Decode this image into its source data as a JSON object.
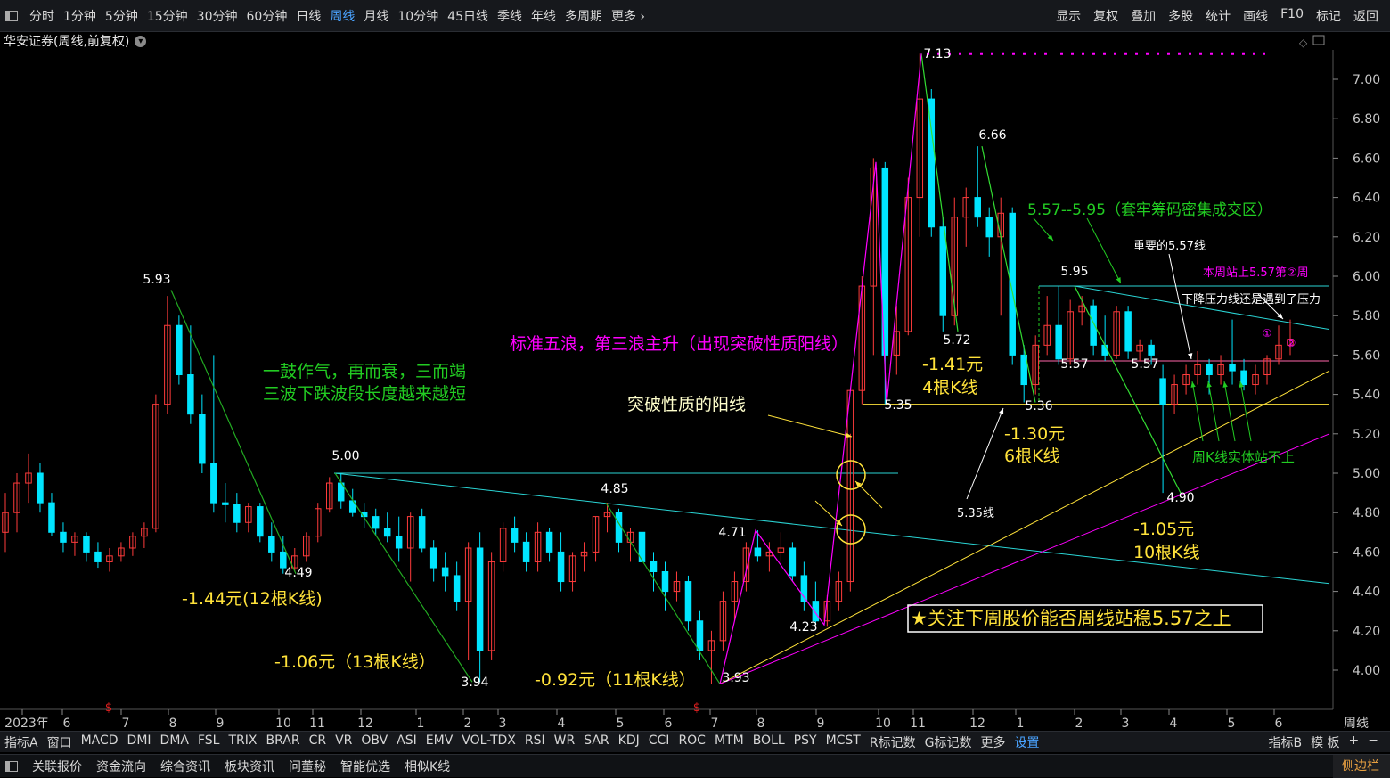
{
  "top_menu": {
    "periods": [
      "分时",
      "1分钟",
      "5分钟",
      "15分钟",
      "30分钟",
      "60分钟",
      "日线",
      "周线",
      "月线",
      "10分钟",
      "45日线",
      "季线",
      "年线",
      "多周期",
      "更多 ›"
    ],
    "active": "周线",
    "right": [
      "显示",
      "复权",
      "叠加",
      "多股",
      "统计",
      "画线",
      "F10",
      "标记",
      "返回"
    ]
  },
  "title": "华安证券(周线,前复权)",
  "price_axis": [
    "7.00",
    "6.80",
    "6.60",
    "6.40",
    "6.20",
    "6.00",
    "5.80",
    "5.60",
    "5.40",
    "5.20",
    "5.00",
    "4.80",
    "4.60",
    "4.40",
    "4.20",
    "4.00"
  ],
  "time_axis": [
    "2023年",
    "6",
    "7",
    "8",
    "9",
    "10",
    "11",
    "12",
    "1",
    "2",
    "3",
    "4",
    "5",
    "6",
    "7",
    "8",
    "9",
    "10",
    "11",
    "12",
    "1",
    "2",
    "3",
    "4",
    "5",
    "6"
  ],
  "time_axis_right": "周线",
  "chart_data": {
    "type": "candlestick",
    "period": "周线",
    "price_labels": [
      "5.93",
      "4.49",
      "5.00",
      "3.94",
      "4.85",
      "3.93",
      "4.71",
      "4.23",
      "7.13",
      "5.35",
      "6.66",
      "5.72",
      "5.36",
      "5.95",
      "5.57",
      "5.57",
      "4.90"
    ],
    "annotations": [
      "一鼓作气，再而衰，三而竭",
      "三波下跌波段长度越来越短",
      "-1.44元(12根K线)",
      "-1.06元（13根K线）",
      "-0.92元（11根K线）",
      "标准五浪，第三浪主升（出现突破性质阳线）",
      "突破性质的阳线",
      "-1.41元",
      "4根K线",
      "-1.30元",
      "6根K线",
      "5.35线",
      "5.57--5.95（套牢筹码密集成交区）",
      "重要的5.57线",
      "本周站上5.57第②周",
      "下降压力线还是遇到了压力",
      "-1.05元",
      "10根K线",
      "周K线实体站不上",
      "★关注下周股价能否周线站稳5.57之上"
    ],
    "circle_marks": [
      "①",
      "②"
    ],
    "candles": [
      [
        4.7,
        4.9,
        4.6,
        4.8
      ],
      [
        4.8,
        5.0,
        4.7,
        4.95
      ],
      [
        4.95,
        5.1,
        4.85,
        5.0
      ],
      [
        5.0,
        5.05,
        4.8,
        4.85
      ],
      [
        4.85,
        4.9,
        4.68,
        4.7
      ],
      [
        4.7,
        4.75,
        4.6,
        4.65
      ],
      [
        4.65,
        4.7,
        4.58,
        4.68
      ],
      [
        4.68,
        4.7,
        4.55,
        4.6
      ],
      [
        4.6,
        4.65,
        4.52,
        4.55
      ],
      [
        4.55,
        4.62,
        4.5,
        4.58
      ],
      [
        4.58,
        4.65,
        4.55,
        4.62
      ],
      [
        4.62,
        4.7,
        4.58,
        4.68
      ],
      [
        4.68,
        4.75,
        4.62,
        4.72
      ],
      [
        4.72,
        5.4,
        4.7,
        5.35
      ],
      [
        5.35,
        5.9,
        5.3,
        5.75
      ],
      [
        5.75,
        5.8,
        5.45,
        5.5
      ],
      [
        5.5,
        5.75,
        5.25,
        5.3
      ],
      [
        5.3,
        5.4,
        5.0,
        5.05
      ],
      [
        5.05,
        5.6,
        4.8,
        4.85
      ],
      [
        4.85,
        4.95,
        4.75,
        4.84
      ],
      [
        4.84,
        4.9,
        4.7,
        4.75
      ],
      [
        4.75,
        4.85,
        4.7,
        4.83
      ],
      [
        4.83,
        4.85,
        4.65,
        4.68
      ],
      [
        4.68,
        4.75,
        4.55,
        4.6
      ],
      [
        4.6,
        4.68,
        4.49,
        4.52
      ],
      [
        4.52,
        4.62,
        4.5,
        4.58
      ],
      [
        4.58,
        4.7,
        4.55,
        4.68
      ],
      [
        4.68,
        4.85,
        4.65,
        4.82
      ],
      [
        4.82,
        4.98,
        4.8,
        4.95
      ],
      [
        4.95,
        5.0,
        4.82,
        4.86
      ],
      [
        4.86,
        4.92,
        4.78,
        4.8
      ],
      [
        4.8,
        4.85,
        4.72,
        4.78
      ],
      [
        4.78,
        4.82,
        4.68,
        4.72
      ],
      [
        4.72,
        4.8,
        4.65,
        4.68
      ],
      [
        4.68,
        4.78,
        4.55,
        4.62
      ],
      [
        4.62,
        4.8,
        4.45,
        4.78
      ],
      [
        4.78,
        4.82,
        4.6,
        4.62
      ],
      [
        4.62,
        4.66,
        4.45,
        4.52
      ],
      [
        4.52,
        4.6,
        4.4,
        4.48
      ],
      [
        4.48,
        4.55,
        4.3,
        4.35
      ],
      [
        4.35,
        4.65,
        4.05,
        4.62
      ],
      [
        4.62,
        4.7,
        3.94,
        4.1
      ],
      [
        4.1,
        4.6,
        4.05,
        4.55
      ],
      [
        4.55,
        4.75,
        4.5,
        4.72
      ],
      [
        4.72,
        4.78,
        4.6,
        4.65
      ],
      [
        4.65,
        4.7,
        4.5,
        4.55
      ],
      [
        4.55,
        4.75,
        4.5,
        4.7
      ],
      [
        4.7,
        4.72,
        4.55,
        4.6
      ],
      [
        4.6,
        4.7,
        4.4,
        4.45
      ],
      [
        4.45,
        4.6,
        4.4,
        4.58
      ],
      [
        4.58,
        4.65,
        4.5,
        4.6
      ],
      [
        4.6,
        4.78,
        4.55,
        4.78
      ],
      [
        4.78,
        4.85,
        4.7,
        4.8
      ],
      [
        4.8,
        4.82,
        4.6,
        4.65
      ],
      [
        4.65,
        4.72,
        4.55,
        4.7
      ],
      [
        4.7,
        4.75,
        4.5,
        4.55
      ],
      [
        4.55,
        4.6,
        4.4,
        4.5
      ],
      [
        4.5,
        4.55,
        4.3,
        4.4
      ],
      [
        4.4,
        4.5,
        4.35,
        4.45
      ],
      [
        4.45,
        4.48,
        4.2,
        4.25
      ],
      [
        4.25,
        4.3,
        4.05,
        4.1
      ],
      [
        4.1,
        4.2,
        3.93,
        4.15
      ],
      [
        4.15,
        4.4,
        4.1,
        4.35
      ],
      [
        4.35,
        4.5,
        4.25,
        4.45
      ],
      [
        4.45,
        4.65,
        4.4,
        4.62
      ],
      [
        4.62,
        4.71,
        4.55,
        4.58
      ],
      [
        4.58,
        4.65,
        4.5,
        4.6
      ],
      [
        4.6,
        4.7,
        4.55,
        4.62
      ],
      [
        4.62,
        4.65,
        4.45,
        4.48
      ],
      [
        4.48,
        4.55,
        4.3,
        4.35
      ],
      [
        4.35,
        4.45,
        4.23,
        4.25
      ],
      [
        4.25,
        4.38,
        4.22,
        4.35
      ],
      [
        4.35,
        4.5,
        4.3,
        4.45
      ],
      [
        4.45,
        5.2,
        4.4,
        5.42
      ],
      [
        5.42,
        6.0,
        5.35,
        5.95
      ],
      [
        5.95,
        6.6,
        5.6,
        6.55
      ],
      [
        6.55,
        6.58,
        5.35,
        5.6
      ],
      [
        5.6,
        5.85,
        5.5,
        5.72
      ],
      [
        5.72,
        6.5,
        5.7,
        6.4
      ],
      [
        6.4,
        7.13,
        6.2,
        6.9
      ],
      [
        6.9,
        6.95,
        6.2,
        6.25
      ],
      [
        6.25,
        6.3,
        5.72,
        5.8
      ],
      [
        5.8,
        6.4,
        5.75,
        6.3
      ],
      [
        6.3,
        6.45,
        6.15,
        6.4
      ],
      [
        6.4,
        6.66,
        6.25,
        6.3
      ],
      [
        6.3,
        6.35,
        6.1,
        6.2
      ],
      [
        6.2,
        6.4,
        5.8,
        6.32
      ],
      [
        6.32,
        6.35,
        5.55,
        5.6
      ],
      [
        5.6,
        5.65,
        5.36,
        5.45
      ],
      [
        5.45,
        5.7,
        5.4,
        5.65
      ],
      [
        5.65,
        5.9,
        5.6,
        5.75
      ],
      [
        5.75,
        5.95,
        5.55,
        5.58
      ],
      [
        5.58,
        5.88,
        5.55,
        5.82
      ],
      [
        5.82,
        5.9,
        5.75,
        5.85
      ],
      [
        5.85,
        5.88,
        5.6,
        5.65
      ],
      [
        5.65,
        5.8,
        5.57,
        5.6
      ],
      [
        5.6,
        5.85,
        5.58,
        5.82
      ],
      [
        5.82,
        5.85,
        5.58,
        5.62
      ],
      [
        5.62,
        5.68,
        5.57,
        5.65
      ],
      [
        5.65,
        5.68,
        5.55,
        5.6
      ],
      [
        5.48,
        5.55,
        4.9,
        5.35
      ],
      [
        5.35,
        5.5,
        5.3,
        5.45
      ],
      [
        5.45,
        5.55,
        5.4,
        5.5
      ],
      [
        5.5,
        5.62,
        5.45,
        5.55
      ],
      [
        5.55,
        5.58,
        5.4,
        5.5
      ],
      [
        5.5,
        5.6,
        5.45,
        5.55
      ],
      [
        5.55,
        5.78,
        5.45,
        5.52
      ],
      [
        5.52,
        5.58,
        5.42,
        5.45
      ],
      [
        5.45,
        5.55,
        5.4,
        5.5
      ],
      [
        5.5,
        5.6,
        5.45,
        5.58
      ],
      [
        5.58,
        5.75,
        5.55,
        5.65
      ],
      [
        5.65,
        5.78,
        5.6,
        5.68
      ]
    ]
  },
  "indicators": [
    "指标A",
    "窗口",
    "MACD",
    "DMI",
    "DMA",
    "FSL",
    "TRIX",
    "BRAR",
    "CR",
    "VR",
    "OBV",
    "ASI",
    "EMV",
    "VOL-TDX",
    "RSI",
    "WR",
    "SAR",
    "KDJ",
    "CCI",
    "ROC",
    "MTM",
    "BOLL",
    "PSY",
    "MCST",
    "R标记数",
    "G标记数",
    "更多",
    "设置"
  ],
  "indicator_right": [
    "指标B",
    "模 板",
    "+",
    "−"
  ],
  "bottom_tabs": [
    "关联报价",
    "资金流向",
    "综合资讯",
    "板块资讯",
    "问董秘",
    "智能优选",
    "相似K线"
  ],
  "side_panel_label": "侧边栏",
  "colors": {
    "up": "#ff3b3b",
    "down": "#00e5ff",
    "axis": "#c8c8c8",
    "magenta": "#ff00ff",
    "yellow": "#ffe23a",
    "green": "#22cc22",
    "cyan": "#2ad4d4",
    "white": "#ffffff"
  }
}
